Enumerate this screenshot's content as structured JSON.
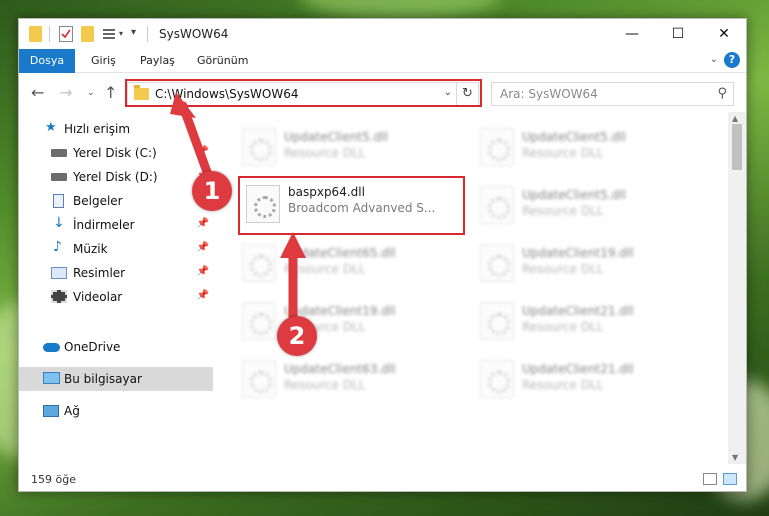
{
  "window": {
    "title": "SysWOW64",
    "controls": {
      "minimize": "—",
      "maximize": "☐",
      "close": "✕"
    }
  },
  "ribbon": {
    "tabs": [
      "Dosya",
      "Giriş",
      "Paylaş",
      "Görünüm"
    ],
    "help": "?"
  },
  "address": {
    "path": "C:\\Windows\\SysWOW64",
    "search_placeholder": "Ara: SysWOW64"
  },
  "nav_pane": {
    "items": [
      {
        "label": "Hızlı erişim",
        "icon": "star-icon"
      },
      {
        "label": "Yerel Disk (C:)",
        "icon": "drive-icon"
      },
      {
        "label": "Yerel Disk (D:)",
        "icon": "drive-icon"
      },
      {
        "label": "Belgeler",
        "icon": "document-icon"
      },
      {
        "label": "İndirmeler",
        "icon": "download-icon"
      },
      {
        "label": "Müzik",
        "icon": "music-icon"
      },
      {
        "label": "Resimler",
        "icon": "picture-icon"
      },
      {
        "label": "Videolar",
        "icon": "video-icon"
      },
      {
        "label": "OneDrive",
        "icon": "cloud-icon"
      },
      {
        "label": "Bu bilgisayar",
        "icon": "computer-icon"
      },
      {
        "label": "Ağ",
        "icon": "network-icon"
      }
    ]
  },
  "files": [
    {
      "name": "UpdateClient5.dll",
      "desc": "Resource DLL"
    },
    {
      "name": "UpdateClient5.dll",
      "desc": "Resource DLL"
    },
    {
      "name": "baspxp64.dll",
      "desc": "Broadcom Advanved S..."
    },
    {
      "name": "UpdateClient5.dll",
      "desc": "Resource DLL"
    },
    {
      "name": "UpdateClient65.dll",
      "desc": "Resource DLL"
    },
    {
      "name": "UpdateClient19.dll",
      "desc": "Resource DLL"
    },
    {
      "name": "UpdateClient19.dll",
      "desc": "Resource DLL"
    },
    {
      "name": "UpdateClient21.dll",
      "desc": "Resource DLL"
    },
    {
      "name": "UpdateClient63.dll",
      "desc": "Resource DLL"
    },
    {
      "name": "UpdateClient21.dll",
      "desc": "Resource DLL"
    }
  ],
  "status": {
    "count": "159 öğe"
  },
  "annotations": {
    "step1": "1",
    "step2": "2"
  },
  "colors": {
    "accent": "#1979ca",
    "highlight": "#d9282e",
    "selected": "#cce8ff"
  }
}
